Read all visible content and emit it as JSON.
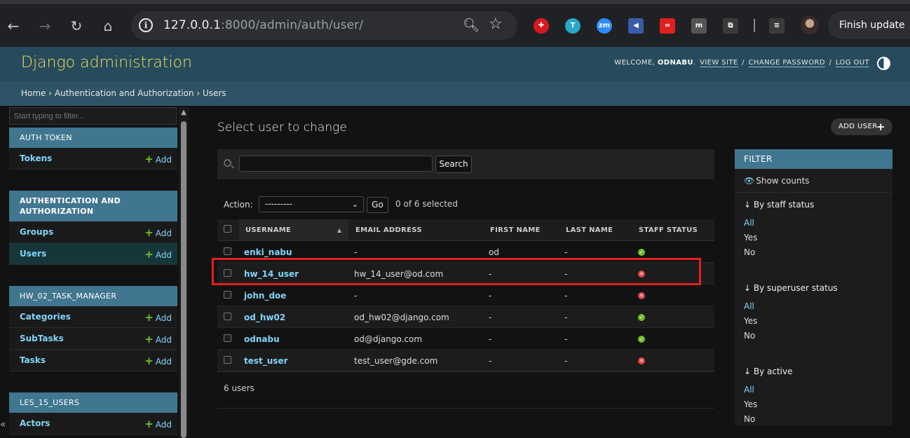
{
  "browser": {
    "url_host": "127.0.0.1",
    "url_path": ":8000/admin/auth/user/",
    "finish_update_label": "Finish update",
    "extensions": [
      {
        "icon": "mendeley-icon",
        "color": "#d71920",
        "text": "✚"
      },
      {
        "icon": "color-wheel-icon",
        "color": "#2aa7c9",
        "text": "T"
      },
      {
        "icon": "zoom-icon",
        "color": "#2d8cff",
        "text": "zm"
      },
      {
        "icon": "megaphone-icon",
        "color": "#3a5ba8",
        "text": "◀"
      },
      {
        "icon": "infinity-icon",
        "color": "#e0201f",
        "text": "∞"
      },
      {
        "icon": "m-extension-icon",
        "color": "#555555",
        "text": "m"
      },
      {
        "icon": "puzzle-icon",
        "color": "#3a3a3a",
        "text": "⧉"
      },
      {
        "icon": "media-queue-icon",
        "color": "#3a3a3a",
        "text": "≡"
      }
    ]
  },
  "header": {
    "branding": "Django administration",
    "welcome": "WELCOME,",
    "username": "ODNABU",
    "view_site": "VIEW SITE",
    "change_password": "CHANGE PASSWORD",
    "log_out": "LOG OUT"
  },
  "breadcrumbs": {
    "home": "Home",
    "app": "Authentication and Authorization",
    "current": "Users",
    "separator": "›"
  },
  "sidebar": {
    "filter_placeholder": "Start typing to filter...",
    "add_label": "Add",
    "modules": [
      {
        "title": "AUTH TOKEN",
        "models": [
          "Tokens"
        ]
      },
      {
        "title": "AUTHENTICATION AND AUTHORIZATION",
        "models": [
          "Groups",
          "Users"
        ]
      },
      {
        "title": "HW_02_TASK_MANAGER",
        "models": [
          "Categories",
          "SubTasks",
          "Tasks"
        ]
      },
      {
        "title": "LES_15_USERS",
        "models": [
          "Actors"
        ]
      }
    ],
    "collapse_symbol": "«"
  },
  "content": {
    "title": "Select user to change",
    "add_user_label": "ADD USER",
    "search_button": "Search",
    "action_label": "Action:",
    "action_value": "---------",
    "go_label": "Go",
    "selected_text": "0 of 6 selected",
    "columns": [
      "USERNAME",
      "EMAIL ADDRESS",
      "FIRST NAME",
      "LAST NAME",
      "STAFF STATUS"
    ],
    "rows": [
      {
        "username": "enki_nabu",
        "email": "-",
        "first": "od",
        "last": "-",
        "staff": true
      },
      {
        "username": "hw_14_user",
        "email": "hw_14_user@od.com",
        "first": "-",
        "last": "-",
        "staff": false
      },
      {
        "username": "john_doe",
        "email": "-",
        "first": "-",
        "last": "-",
        "staff": false
      },
      {
        "username": "od_hw02",
        "email": "od_hw02@django.com",
        "first": "-",
        "last": "-",
        "staff": true
      },
      {
        "username": "odnabu",
        "email": "od@django.com",
        "first": "-",
        "last": "-",
        "staff": true
      },
      {
        "username": "test_user",
        "email": "test_user@gde.com",
        "first": "-",
        "last": "-",
        "staff": false
      }
    ],
    "count_text": "6 users"
  },
  "filter": {
    "title": "FILTER",
    "show_counts": "Show counts",
    "groups": [
      {
        "title": "↓ By staff status",
        "options": [
          "All",
          "Yes",
          "No"
        ]
      },
      {
        "title": "↓ By superuser status",
        "options": [
          "All",
          "Yes",
          "No"
        ]
      },
      {
        "title": "↓ By active",
        "options": [
          "All",
          "Yes",
          "No"
        ]
      }
    ]
  },
  "colors": {
    "header_bg": "#264b5d",
    "branding": "#f5dd5d",
    "link": "#81d4fa",
    "module_head": "#417690",
    "highlight_box": "#e0201f"
  }
}
